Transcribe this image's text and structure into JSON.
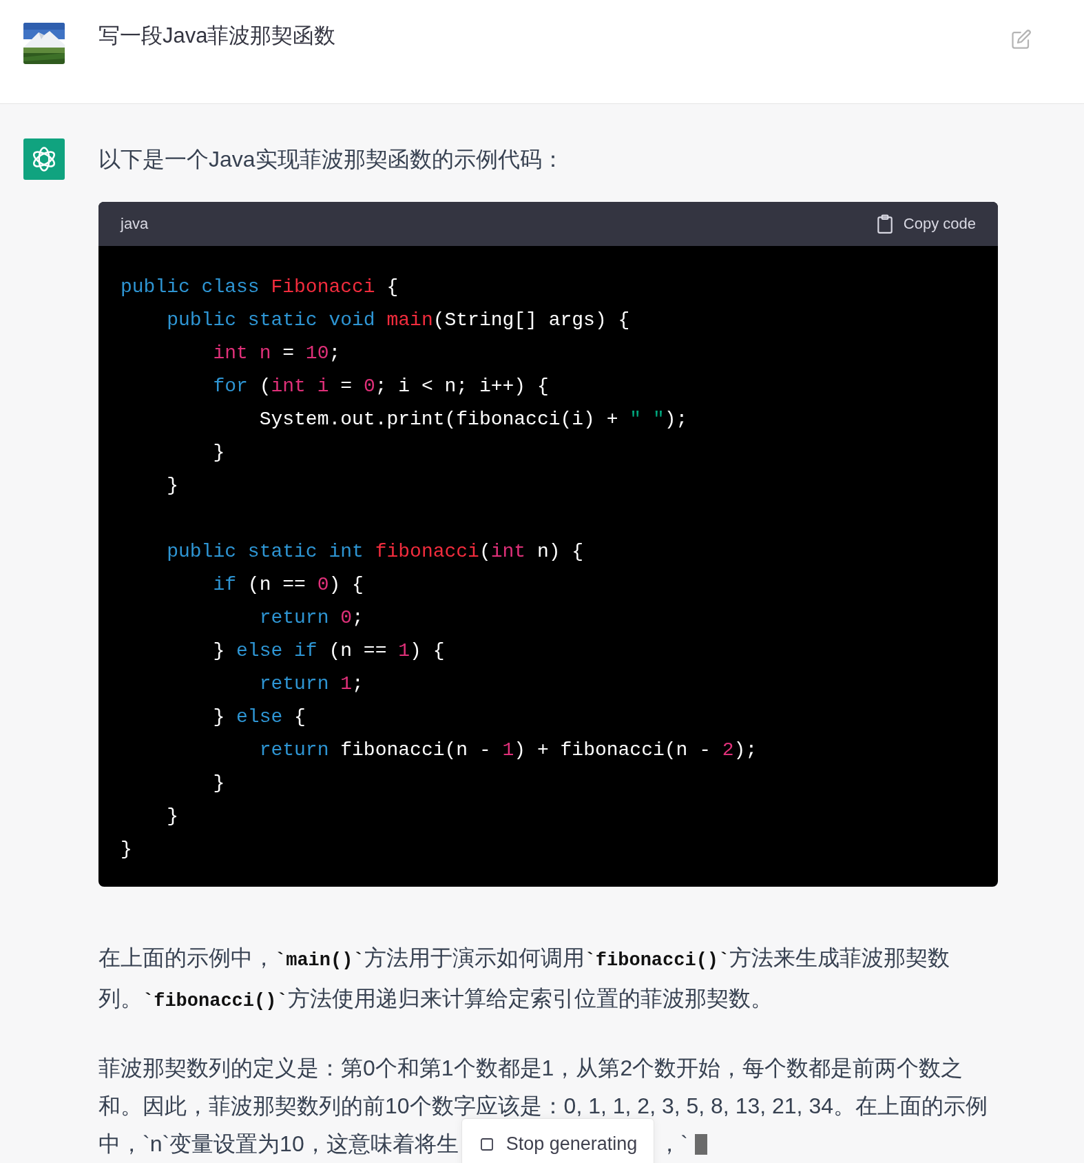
{
  "user_message": {
    "text": "写一段Java菲波那契函数"
  },
  "assistant_message": {
    "intro": "以下是一个Java实现菲波那契函数的示例代码：",
    "code_block": {
      "language": "java",
      "copy_label": "Copy code",
      "lines": [
        {
          "kind": "code",
          "tokens": [
            {
              "kind": "kw",
              "text": "public class "
            },
            {
              "kind": "title",
              "text": "Fibonacci"
            },
            {
              "kind": "plain",
              "text": " {"
            }
          ]
        },
        {
          "kind": "code",
          "tokens": [
            {
              "kind": "kw",
              "text": "    public static void "
            },
            {
              "kind": "title",
              "text": "main"
            },
            {
              "kind": "plain",
              "text": "(String[] args) {"
            }
          ]
        },
        {
          "kind": "code",
          "tokens": [
            {
              "kind": "num",
              "text": "        int n"
            },
            {
              "kind": "plain",
              "text": " = "
            },
            {
              "kind": "num",
              "text": "10"
            },
            {
              "kind": "plain",
              "text": ";"
            }
          ]
        },
        {
          "kind": "code",
          "tokens": [
            {
              "kind": "kw",
              "text": "        for"
            },
            {
              "kind": "plain",
              "text": " ("
            },
            {
              "kind": "num",
              "text": "int i"
            },
            {
              "kind": "plain",
              "text": " = "
            },
            {
              "kind": "num",
              "text": "0"
            },
            {
              "kind": "plain",
              "text": "; i < n; i++) {"
            }
          ]
        },
        {
          "kind": "code",
          "tokens": [
            {
              "kind": "plain",
              "text": "            System.out.print(fibonacci(i) + "
            },
            {
              "kind": "str",
              "text": "\" \""
            },
            {
              "kind": "plain",
              "text": ");"
            }
          ]
        },
        {
          "kind": "code",
          "tokens": [
            {
              "kind": "plain",
              "text": "        }"
            }
          ]
        },
        {
          "kind": "code",
          "tokens": [
            {
              "kind": "plain",
              "text": "    }"
            }
          ]
        },
        {
          "kind": "blank"
        },
        {
          "kind": "code",
          "tokens": [
            {
              "kind": "kw",
              "text": "    public static int "
            },
            {
              "kind": "title",
              "text": "fibonacci"
            },
            {
              "kind": "plain",
              "text": "("
            },
            {
              "kind": "num",
              "text": "int"
            },
            {
              "kind": "plain",
              "text": " n) {"
            }
          ]
        },
        {
          "kind": "code",
          "tokens": [
            {
              "kind": "kw",
              "text": "        if"
            },
            {
              "kind": "plain",
              "text": " (n == "
            },
            {
              "kind": "num",
              "text": "0"
            },
            {
              "kind": "plain",
              "text": ") {"
            }
          ]
        },
        {
          "kind": "code",
          "tokens": [
            {
              "kind": "kw",
              "text": "            return"
            },
            {
              "kind": "num",
              "text": " 0"
            },
            {
              "kind": "plain",
              "text": ";"
            }
          ]
        },
        {
          "kind": "code",
          "tokens": [
            {
              "kind": "plain",
              "text": "        } "
            },
            {
              "kind": "kw",
              "text": "else if"
            },
            {
              "kind": "plain",
              "text": " (n == "
            },
            {
              "kind": "num",
              "text": "1"
            },
            {
              "kind": "plain",
              "text": ") {"
            }
          ]
        },
        {
          "kind": "code",
          "tokens": [
            {
              "kind": "kw",
              "text": "            return"
            },
            {
              "kind": "num",
              "text": " 1"
            },
            {
              "kind": "plain",
              "text": ";"
            }
          ]
        },
        {
          "kind": "code",
          "tokens": [
            {
              "kind": "plain",
              "text": "        } "
            },
            {
              "kind": "kw",
              "text": "else"
            },
            {
              "kind": "plain",
              "text": " {"
            }
          ]
        },
        {
          "kind": "code",
          "tokens": [
            {
              "kind": "kw",
              "text": "            return"
            },
            {
              "kind": "plain",
              "text": " fibonacci(n - "
            },
            {
              "kind": "num",
              "text": "1"
            },
            {
              "kind": "plain",
              "text": ") + fibonacci(n - "
            },
            {
              "kind": "num",
              "text": "2"
            },
            {
              "kind": "plain",
              "text": ");"
            }
          ]
        },
        {
          "kind": "code",
          "tokens": [
            {
              "kind": "plain",
              "text": "        }"
            }
          ]
        },
        {
          "kind": "code",
          "tokens": [
            {
              "kind": "plain",
              "text": "    }"
            }
          ]
        },
        {
          "kind": "code",
          "tokens": [
            {
              "kind": "plain",
              "text": "}"
            }
          ]
        }
      ]
    },
    "paragraphs": [
      {
        "segments": [
          {
            "kind": "text",
            "text": "在上面的示例中，"
          },
          {
            "kind": "code",
            "text": "`main()`"
          },
          {
            "kind": "text",
            "text": "方法用于演示如何调用"
          },
          {
            "kind": "code",
            "text": "`fibonacci()`"
          },
          {
            "kind": "text",
            "text": "方法来生成菲波那契数列。"
          },
          {
            "kind": "code",
            "text": "`fibonacci()`"
          },
          {
            "kind": "text",
            "text": "方法使用递归来计算给定索引位置的菲波那契数。"
          }
        ]
      },
      {
        "segments": [
          {
            "kind": "text",
            "text": "菲波那契数列的定义是：第0个和第1个数都是1，从第2个数开始，每个数都是前两个数之和。因此，菲波那契数列的前10个数字应该是：0, 1, 1, 2, 3, 5, 8, 13, 21, 34。在上面的示例"
          }
        ]
      }
    ],
    "last_line": {
      "before": "中，`n`变量设置为10，这意味着将生",
      "after": "，`"
    },
    "stop_button": {
      "label": "Stop generating"
    }
  }
}
